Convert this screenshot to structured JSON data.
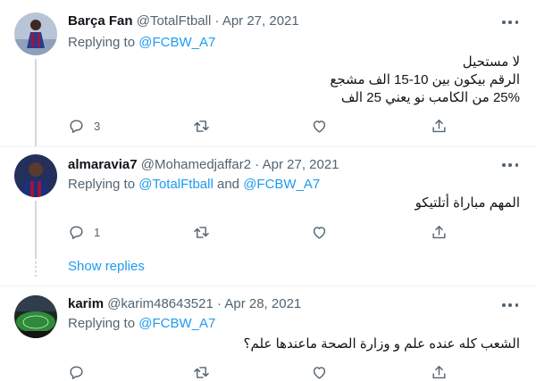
{
  "colors": {
    "accent": "#1d9bf0",
    "muted": "#536471",
    "text": "#0f1419",
    "line": "#cfd9de"
  },
  "tweets": [
    {
      "name": "Barça Fan",
      "handle": "@TotalFtball",
      "sep": "·",
      "date": "Apr 27, 2021",
      "replying_prefix": "Replying to ",
      "mention1": "@FCBW_A7",
      "mention_join": "",
      "mention2": "",
      "lines": [
        "لا مستحيل",
        "الرقم بيكون بين 10-15 الف مشجع",
        "25% من الكامب نو يعني 25 الف"
      ],
      "reply_count": "3",
      "avatar_icon": "soccer-player-avatar"
    },
    {
      "name": "almaravia7",
      "handle": "@Mohamedjaffar2",
      "sep": "·",
      "date": "Apr 27, 2021",
      "replying_prefix": "Replying to ",
      "mention1": "@TotalFtball",
      "mention_join": " and ",
      "mention2": "@FCBW_A7",
      "lines": [
        "المهم مباراة أتلتيكو"
      ],
      "reply_count": "1",
      "avatar_icon": "player-portrait-avatar"
    },
    {
      "name": "karim",
      "handle": "@karim48643521",
      "sep": "·",
      "date": "Apr 28, 2021",
      "replying_prefix": "Replying to ",
      "mention1": "@FCBW_A7",
      "mention_join": "",
      "mention2": "",
      "lines": [
        "الشعب كله عنده علم و وزارة الصحة ماعندها علم؟"
      ],
      "reply_count": "",
      "avatar_icon": "stadium-avatar"
    }
  ],
  "show_replies": "Show replies",
  "icons": [
    "reply-icon",
    "retweet-icon",
    "like-icon",
    "share-icon",
    "more-icon"
  ]
}
